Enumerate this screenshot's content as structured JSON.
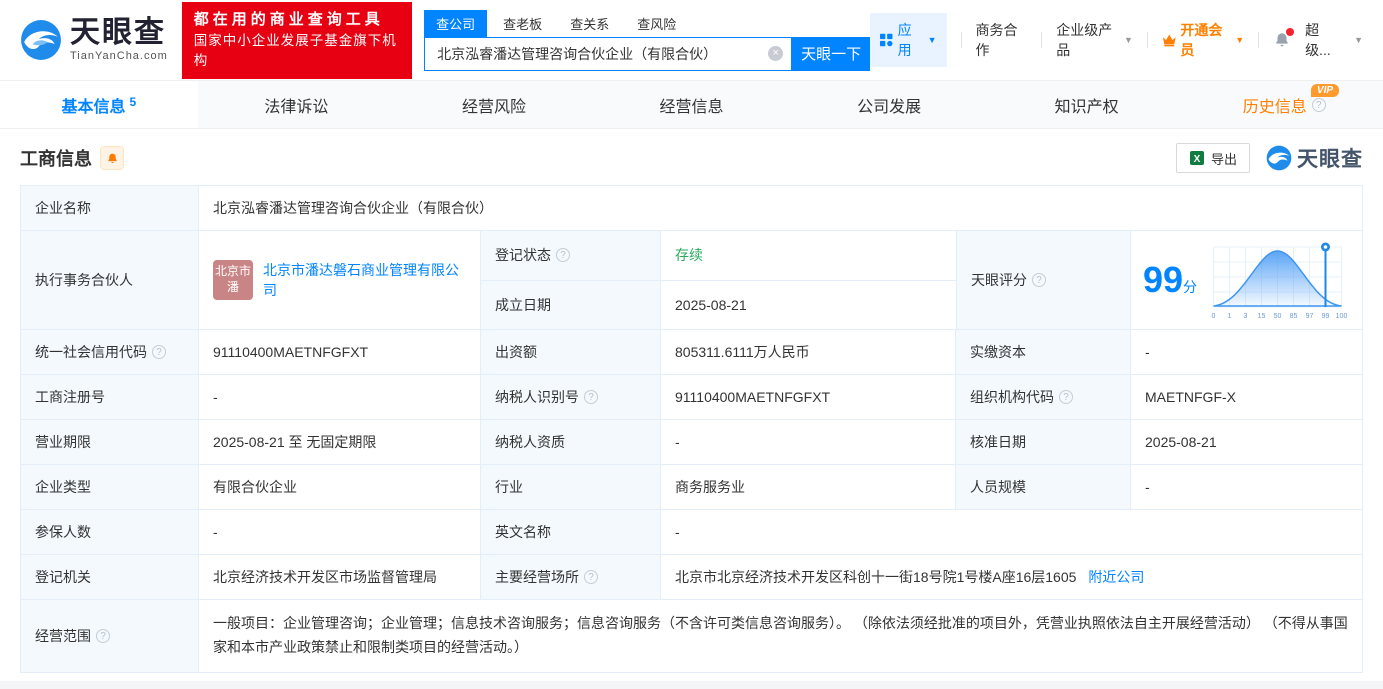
{
  "brand": {
    "name": "天眼查",
    "domain": "TianYanCha.com",
    "promo1": "都在用的商业查询工具",
    "promo2": "国家中小企业发展子基金旗下机构",
    "watermark": "天眼查"
  },
  "search": {
    "tabs": [
      "查公司",
      "查老板",
      "查关系",
      "查风险"
    ],
    "value": "北京泓睿潘达管理咨询合伙企业（有限合伙）",
    "button": "天眼一下"
  },
  "topnav": {
    "apps": "应用",
    "cooperation": "商务合作",
    "enterprise": "企业级产品",
    "vip": "开通会员",
    "user": "超级..."
  },
  "tabs": {
    "basic": "基本信息",
    "basic_count": "5",
    "legal": "法律诉讼",
    "risk": "经营风险",
    "operation": "经营信息",
    "development": "公司发展",
    "ip": "知识产权",
    "history": "历史信息",
    "vip_badge": "VIP"
  },
  "section": {
    "title": "工商信息",
    "export": "导出"
  },
  "info": {
    "company_name_label": "企业名称",
    "company_name": "北京泓睿潘达管理咨询合伙企业（有限合伙）",
    "partner_label": "执行事务合伙人",
    "partner_avatar": "北京市潘",
    "partner_name": "北京市潘达磐石商业管理有限公司",
    "status_label": "登记状态",
    "status": "存续",
    "established_label": "成立日期",
    "established": "2025-08-21",
    "score_label": "天眼评分",
    "score": "99",
    "score_unit": "分",
    "uscc_label": "统一社会信用代码",
    "uscc": "91110400MAETNFGFXT",
    "capital_label": "出资额",
    "capital": "805311.6111万人民币",
    "paid_label": "实缴资本",
    "paid": "-",
    "regno_label": "工商注册号",
    "regno": "-",
    "taxid_label": "纳税人识别号",
    "taxid": "91110400MAETNFGFXT",
    "orgcode_label": "组织机构代码",
    "orgcode": "MAETNFGF-X",
    "term_label": "营业期限",
    "term": "2025-08-21 至 无固定期限",
    "taxqual_label": "纳税人资质",
    "taxqual": "-",
    "approve_label": "核准日期",
    "approve": "2025-08-21",
    "type_label": "企业类型",
    "type": "有限合伙企业",
    "industry_label": "行业",
    "industry": "商务服务业",
    "staff_label": "人员规模",
    "staff": "-",
    "insured_label": "参保人数",
    "insured": "-",
    "engname_label": "英文名称",
    "engname": "-",
    "authority_label": "登记机关",
    "authority": "北京经济技术开发区市场监督管理局",
    "address_label": "主要经营场所",
    "address": "北京市北京经济技术开发区科创十一街18号院1号楼A座16层1605",
    "address_link": "附近公司",
    "scope_label": "经营范围",
    "scope": "一般项目：企业管理咨询；企业管理；信息技术咨询服务；信息咨询服务（不含许可类信息咨询服务）。 （除依法须经批准的项目外，凭营业执照依法自主开展经营活动） （不得从事国家和本市产业政策禁止和限制类项目的经营活动。）"
  },
  "score_chart": {
    "type": "area",
    "ticks": [
      "0",
      "1",
      "3",
      "15",
      "50",
      "85",
      "97",
      "99",
      "100"
    ],
    "marker_value": "99",
    "curve_color": "#4a9bf5",
    "marker_color": "#1e88e5"
  },
  "colors": {
    "accent": "#0084ff",
    "promo_red": "#e60012",
    "vip_orange": "#ff8000",
    "status_green": "#2bab5e"
  }
}
